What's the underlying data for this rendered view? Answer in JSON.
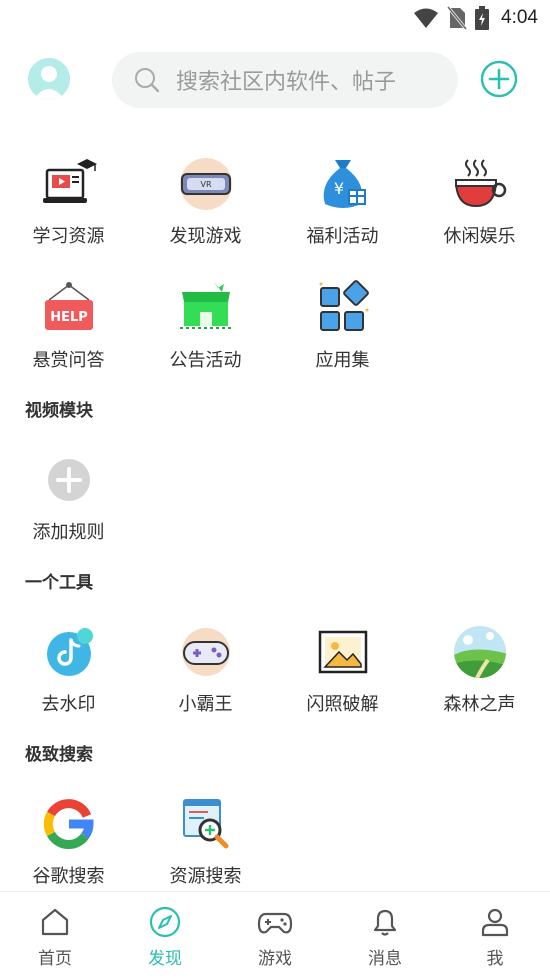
{
  "status_bar": {
    "time": "4:04"
  },
  "search": {
    "placeholder": "搜索社区内软件、帖子"
  },
  "colors": {
    "accent": "#2bbfb0",
    "inactive": "#555555"
  },
  "grid_top": [
    {
      "label": "学习资源",
      "icon": "study-icon"
    },
    {
      "label": "发现游戏",
      "icon": "vr-headset-icon"
    },
    {
      "label": "福利活动",
      "icon": "money-bag-icon"
    },
    {
      "label": "休闲娱乐",
      "icon": "coffee-cup-icon"
    },
    {
      "label": "悬赏问答",
      "icon": "help-sign-icon"
    },
    {
      "label": "公告活动",
      "icon": "shop-icon"
    },
    {
      "label": "应用集",
      "icon": "apps-icon"
    }
  ],
  "sections": {
    "video": {
      "title": "视频模块",
      "items": [
        {
          "label": "添加规则",
          "icon": "add-rule-icon"
        }
      ]
    },
    "tools": {
      "title": "一个工具",
      "items": [
        {
          "label": "去水印",
          "icon": "tiktok-icon"
        },
        {
          "label": "小霸王",
          "icon": "gamepad-icon"
        },
        {
          "label": "闪照破解",
          "icon": "image-icon"
        },
        {
          "label": "森林之声",
          "icon": "landscape-icon"
        }
      ]
    },
    "search": {
      "title": "极致搜索",
      "items": [
        {
          "label": "谷歌搜索",
          "icon": "google-icon"
        },
        {
          "label": "资源搜索",
          "icon": "resource-search-icon"
        }
      ]
    }
  },
  "bottom_nav": [
    {
      "label": "首页",
      "icon": "home-icon",
      "active": false
    },
    {
      "label": "发现",
      "icon": "compass-icon",
      "active": true
    },
    {
      "label": "游戏",
      "icon": "gamepad-nav-icon",
      "active": false
    },
    {
      "label": "消息",
      "icon": "bell-icon",
      "active": false
    },
    {
      "label": "我",
      "icon": "profile-icon",
      "active": false
    }
  ]
}
